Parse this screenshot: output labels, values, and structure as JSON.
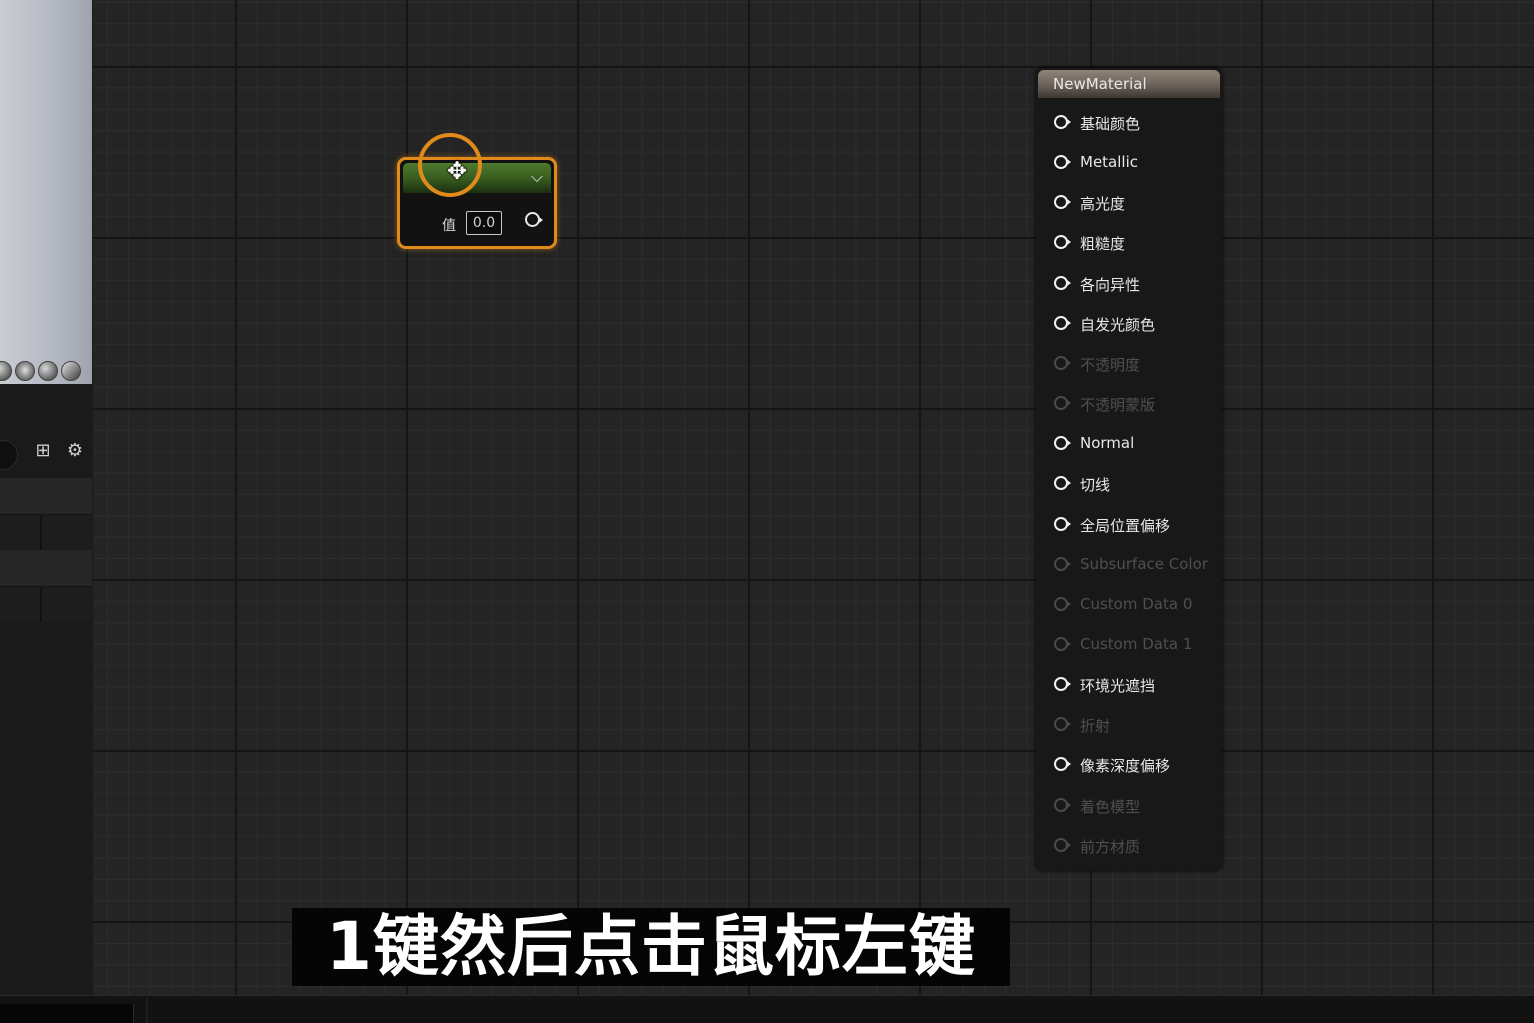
{
  "material_node": {
    "title": "NewMaterial",
    "pins": [
      {
        "label": "基础颜色",
        "enabled": true
      },
      {
        "label": "Metallic",
        "enabled": true
      },
      {
        "label": "高光度",
        "enabled": true
      },
      {
        "label": "粗糙度",
        "enabled": true
      },
      {
        "label": "各向异性",
        "enabled": true
      },
      {
        "label": "自发光颜色",
        "enabled": true
      },
      {
        "label": "不透明度",
        "enabled": false
      },
      {
        "label": "不透明蒙版",
        "enabled": false
      },
      {
        "label": "Normal",
        "enabled": true
      },
      {
        "label": "切线",
        "enabled": true
      },
      {
        "label": "全局位置偏移",
        "enabled": true
      },
      {
        "label": "Subsurface Color",
        "enabled": false
      },
      {
        "label": "Custom Data 0",
        "enabled": false
      },
      {
        "label": "Custom Data 1",
        "enabled": false
      },
      {
        "label": "环境光遮挡",
        "enabled": true
      },
      {
        "label": "折射",
        "enabled": false
      },
      {
        "label": "像素深度偏移",
        "enabled": true
      },
      {
        "label": "着色模型",
        "enabled": false
      },
      {
        "label": "前方材质",
        "enabled": false
      }
    ]
  },
  "scalar_node": {
    "value_label": "值",
    "value": "0.0",
    "header_color": "#4f7a2e",
    "selection_color": "#e08a1c"
  },
  "left_panel": {
    "icons": [
      "table-icon",
      "gear-icon"
    ]
  },
  "subtitle": "1键然后点击鼠标左键"
}
